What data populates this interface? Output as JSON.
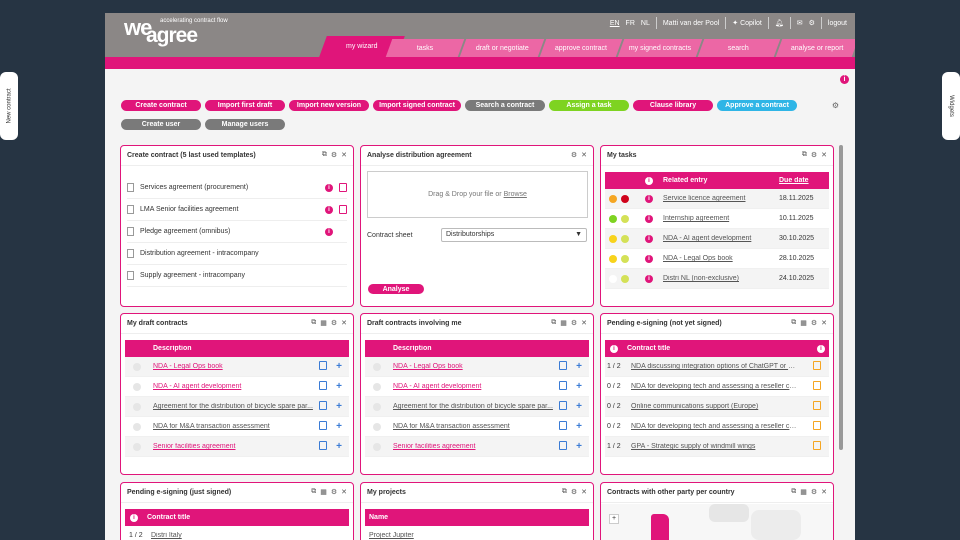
{
  "side": {
    "left_tab": "New contract",
    "right_tab": "Widgets"
  },
  "brand": {
    "we": "we",
    "agree": "agree",
    "tagline": "accelerating contract flow",
    "accent": "#e0157a"
  },
  "topbar": {
    "lang_en": "EN",
    "lang_fr": "FR",
    "lang_nl": "NL",
    "user": "Matti van der Pool",
    "copilot": "Copilot",
    "logout": "logout"
  },
  "nav": [
    "my wizard",
    "tasks",
    "draft or negotiate",
    "approve contract",
    "my signed contracts",
    "search",
    "analyse or report"
  ],
  "buttons_row1": [
    "Create contract",
    "Import first draft",
    "Import new version",
    "Import signed contract",
    "Search a contract",
    "Assign a task",
    "Clause library",
    "Approve a contract"
  ],
  "buttons_row2": [
    "Create user",
    "Manage users"
  ],
  "create_widget": {
    "title": "Create contract (5 last used templates)",
    "items": [
      "Services agreement (procurement)",
      "LMA Senior facilities agreement",
      "Pledge agreement (omnibus)",
      "Distribution agreement - intracompany",
      "Supply agreement - intracompany"
    ]
  },
  "analyse_widget": {
    "title": "Analyse distribution agreement",
    "drop_text": "Drag & Drop your file or",
    "browse": "Browse",
    "sheet_label": "Contract sheet",
    "sheet_value": "Distributorships",
    "button": "Analyse"
  },
  "tasks_widget": {
    "title": "My tasks",
    "col_entry": "Related entry",
    "col_date": "Due date",
    "rows": [
      {
        "entry": "Service licence agreement",
        "date": "18.11.2025",
        "c1": "#f5a623",
        "c2": "#d0021b"
      },
      {
        "entry": "Internship agreement",
        "date": "10.11.2025",
        "c1": "#7ed321",
        "c2": "#d4e157"
      },
      {
        "entry": "NDA - AI agent development",
        "date": "30.10.2025",
        "c1": "#f8d31c",
        "c2": "#d4e157"
      },
      {
        "entry": "NDA - Legal Ops book",
        "date": "28.10.2025",
        "c1": "#f8d31c",
        "c2": "#d4e157"
      },
      {
        "entry": "Distri NL (non-exclusive)",
        "date": "24.10.2025",
        "c1": "",
        "c2": "#d4e157"
      }
    ]
  },
  "draft_widget": {
    "title": "My draft contracts",
    "col": "Description",
    "rows": [
      {
        "text": "NDA - Legal Ops book",
        "pink": true
      },
      {
        "text": "NDA - AI agent development",
        "pink": true
      },
      {
        "text": "Agreement for the distribution of bicycle spare par...",
        "pink": false
      },
      {
        "text": "NDA for M&A transaction assessment",
        "pink": false
      },
      {
        "text": "Senior facilities agreement",
        "pink": true
      }
    ]
  },
  "involving_widget": {
    "title": "Draft contracts involving me",
    "col": "Description",
    "rows": [
      {
        "text": "NDA - Legal Ops book",
        "pink": true
      },
      {
        "text": "NDA - AI agent development",
        "pink": true
      },
      {
        "text": "Agreement for the distribution of bicycle spare par...",
        "pink": false
      },
      {
        "text": "NDA for M&A transaction assessment",
        "pink": false
      },
      {
        "text": "Senior facilities agreement",
        "pink": true
      }
    ]
  },
  "pending_widget": {
    "title": "Pending e-signing (not yet signed)",
    "col": "Contract title",
    "rows": [
      {
        "count": "1 / 2",
        "text": "NDA discussing integration options of ChatGPT or O..."
      },
      {
        "count": "0 / 2",
        "text": "NDA for developing tech and assessing a reseller col..."
      },
      {
        "count": "0 / 2",
        "text": "Online communications support (Europe)"
      },
      {
        "count": "0 / 2",
        "text": "NDA for developing tech and assessing a reseller col..."
      },
      {
        "count": "1 / 2",
        "text": "GPA - Strategic supply of windmill wings"
      }
    ]
  },
  "bottom": {
    "signed_title": "Pending e-signing (just signed)",
    "signed_col": "Contract title",
    "signed_first": "Distri Italy",
    "signed_count": "1 / 2",
    "projects_title": "My projects",
    "projects_col": "Name",
    "projects_first": "Project Jupiter",
    "map_title": "Contracts with other party per country"
  }
}
